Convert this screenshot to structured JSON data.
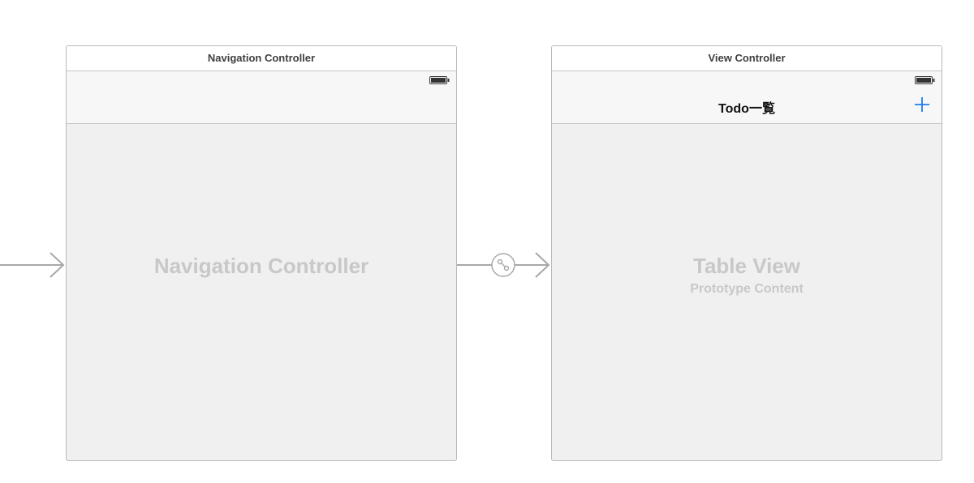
{
  "navigation_controller": {
    "title": "Navigation Controller",
    "placeholder": "Navigation Controller",
    "icons": [
      "battery-icon"
    ]
  },
  "view_controller": {
    "title": "View Controller",
    "nav_title": "Todo一覧",
    "add_button_icon": "plus-icon",
    "placeholder_title": "Table View",
    "placeholder_subtitle": "Prototype Content",
    "icons": [
      "battery-icon",
      "plus-icon"
    ]
  },
  "segues": {
    "entry_arrow_icon": "arrow-icon",
    "relationship_icon": "segue-link-icon"
  },
  "colors": {
    "accent": "#1e7cf2",
    "placeholder_text": "#c8c8c8",
    "canvas": "#ffffff",
    "scene_background": "#f0f0f0",
    "connector": "#a8a8a8"
  }
}
